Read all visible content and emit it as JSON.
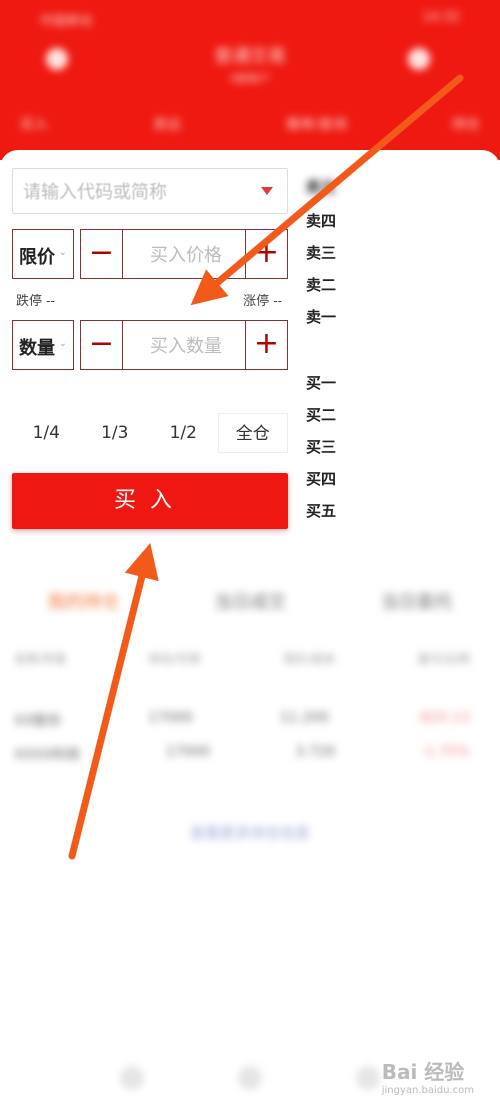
{
  "colors": {
    "brand_red": "#ee1a12",
    "arrow_orange": "#f25a1c",
    "minus_plus": "#b00000"
  },
  "header": {
    "status_left": "中国移动",
    "status_right": "14:32",
    "title": "普通交易",
    "subtitle": "A股账户",
    "tabs": [
      "买入",
      "卖出",
      "撤单/查询",
      "持仓"
    ]
  },
  "order": {
    "stock_placeholder": "请输入代码或简称",
    "price_type": "限价",
    "price_placeholder": "买入价格",
    "limit_down": "跌停 --",
    "limit_up": "涨停 --",
    "qty_type": "数量",
    "qty_placeholder": "买入数量",
    "minus": "−",
    "plus": "+",
    "fractions": [
      "1/4",
      "1/3",
      "1/2",
      "全仓"
    ],
    "buy_label": "买入"
  },
  "orderbook": {
    "sell": [
      "卖五",
      "卖四",
      "卖三",
      "卖二",
      "卖一"
    ],
    "buy": [
      "买一",
      "买二",
      "买三",
      "买四",
      "买五"
    ]
  },
  "positions": {
    "tabs": [
      "我的持仓",
      "当日成交",
      "当日委托"
    ],
    "columns": [
      "名称/市值",
      "持仓/可用",
      "现价/成本",
      "盈亏/比例"
    ],
    "rows": [
      [
        "XX股份",
        "17000",
        "11.200",
        "-820.13"
      ],
      [
        "XXXX科技",
        "17000",
        "3.720",
        "-1.75%"
      ]
    ],
    "more": "查看更多持仓信息"
  },
  "watermark": {
    "text": "Bai 经验",
    "sub": "jingyan.baidu.com"
  }
}
